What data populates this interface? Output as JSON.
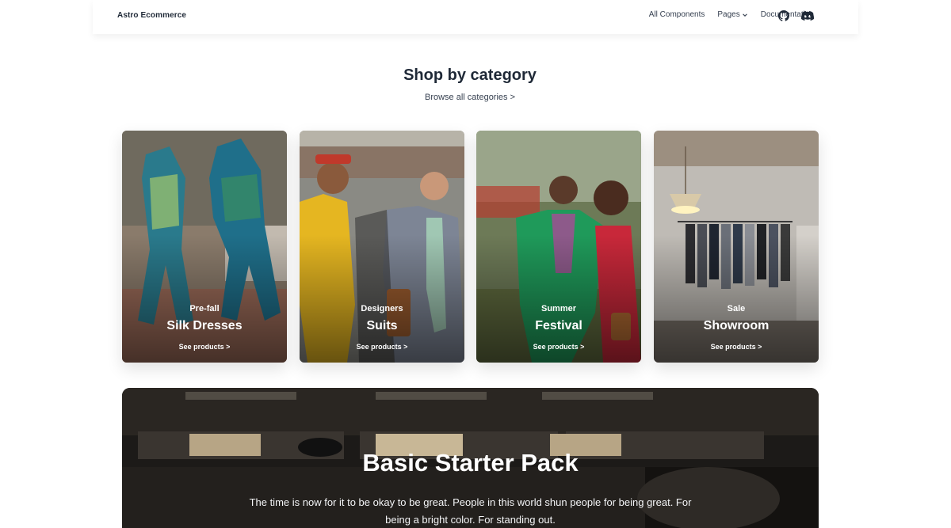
{
  "navbar": {
    "brand": "Astro Ecommerce",
    "links": {
      "all_components": "All Components",
      "pages": "Pages",
      "documentation": "Documentation"
    },
    "icons": [
      "github-icon",
      "discord-icon"
    ]
  },
  "section": {
    "title": "Shop by category",
    "browse_link": "Browse all categories >"
  },
  "categories": [
    {
      "subtitle": "Pre-fall",
      "title": "Silk Dresses",
      "link": "See products >"
    },
    {
      "subtitle": "Designers",
      "title": "Suits",
      "link": "See products >"
    },
    {
      "subtitle": "Summer",
      "title": "Festival",
      "link": "See products >"
    },
    {
      "subtitle": "Sale",
      "title": "Showroom",
      "link": "See products >"
    }
  ],
  "banner": {
    "title": "Basic Starter Pack",
    "text": "The time is now for it to be okay to be great. People in this world shun people for being great. For being a bright color. For standing out."
  },
  "colors": {
    "text_primary": "#1f2937",
    "banner_bg": "#1a1715"
  }
}
